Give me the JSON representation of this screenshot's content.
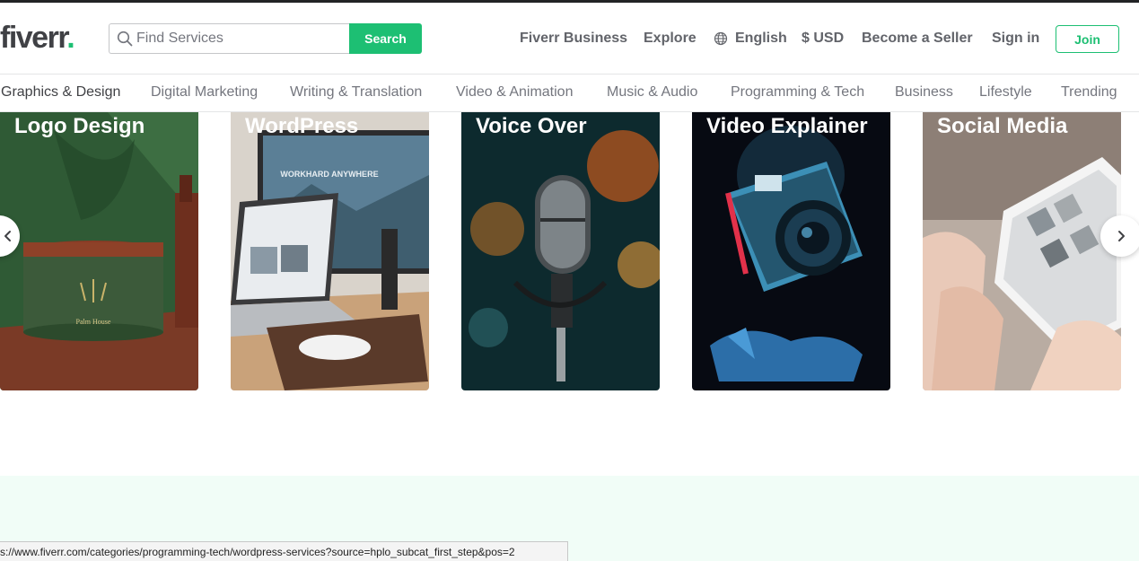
{
  "header": {
    "logo_text": "fiverr",
    "logo_dot": ".",
    "search_placeholder": "Find Services",
    "search_button": "Search",
    "nav": {
      "business": "Fiverr Business",
      "explore": "Explore",
      "language": "English",
      "currency": "$ USD",
      "become_seller": "Become a Seller",
      "sign_in": "Sign in",
      "join": "Join"
    }
  },
  "categories": [
    "Graphics & Design",
    "Digital Marketing",
    "Writing & Translation",
    "Video & Animation",
    "Music & Audio",
    "Programming & Tech",
    "Business",
    "Lifestyle",
    "Trending"
  ],
  "cards": [
    {
      "title": "Logo Design",
      "image_text": "Palm House"
    },
    {
      "title": "WordPress",
      "image_text": "WORKHARD ANYWHERE"
    },
    {
      "title": "Voice Over"
    },
    {
      "title": "Video Explainer"
    },
    {
      "title": "Social Media"
    }
  ],
  "status_url": "s://www.fiverr.com/categories/programming-tech/wordpress-services?source=hplo_subcat_first_step&pos=2",
  "colors": {
    "brand_green": "#1dbf73",
    "text_dark": "#404145",
    "mint_bg": "#f1fdf7"
  }
}
